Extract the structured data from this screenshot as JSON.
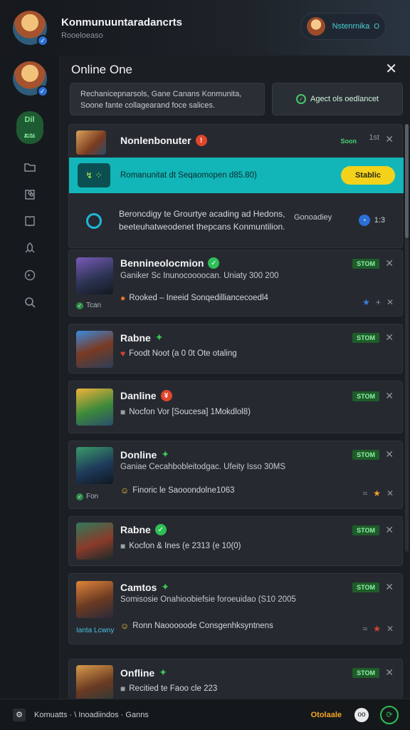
{
  "header": {
    "title": "Konmunuuntaradancrts",
    "subtitle": "Rooeloeaso",
    "user_name": "Nstenrnika",
    "user_status": "O"
  },
  "sidebar": {
    "pill_top": "Dil",
    "pill_bottom": "ಖಜ"
  },
  "panel": {
    "title": "Online One",
    "close": "✕",
    "info_text": "Rechanicepnarsols, Gane Canans Konmunita, Soone fante collagearand foce salices.",
    "select_label": "Agect ols oedlancet"
  },
  "highlight": {
    "title": "Nonlenbonuter",
    "tag": "Soon",
    "tag_extra": "1st",
    "teal_icon": "↯ ⁘",
    "teal_text": "Romanunitat dt Seqaomopen d85.80)",
    "play_label": "Stablic",
    "desc": "Beroncdigy te Grourtye acading ad Hedons, beeteuhatweodenet thepcans Konmuntilion.",
    "desc_right": "Gonoadiey",
    "score": "1:3"
  },
  "cards": [
    {
      "title": "Bennineolocmion",
      "badge": "ok",
      "line": "Ganiker Sc Inunocoooocan. Uniaty 300 200",
      "sub": "Rooked – Ineeid Sonqedilliancecoedl4",
      "tag": "STOM",
      "side": "Tcan"
    },
    {
      "title": "Rabne",
      "badge": "leaf",
      "line": "",
      "sub": "Foodt Noot (a 0 0t Ote otaling",
      "tag": "STOM",
      "side": ""
    },
    {
      "title": "Danline",
      "badge": "warn",
      "line": "",
      "sub": "Nocfon Vor [Soucesa] 1Mokdlol8)",
      "tag": "STOM",
      "side": ""
    },
    {
      "title": "Donline",
      "badge": "leaf",
      "line": "Ganiae Cecahbobleitodgac. Ufeity Isso 30MS",
      "sub": "Finoric le Saooondolne1063",
      "tag": "STOM",
      "side": "Fon"
    },
    {
      "title": "Rabne",
      "badge": "ok",
      "line": "",
      "sub": "Kocfon & Ines (e 2313 (e 10(0)",
      "tag": "STOM",
      "side": ""
    },
    {
      "title": "Camtos",
      "badge": "leaf",
      "line": "Somisosie Onahioobiefsie foroeuidao (S10 2005",
      "sub": "Ronn Naooooode Consgenhksyntnens",
      "tag": "STOM",
      "side": "Ianta Lcwny"
    },
    {
      "title": "Onfline",
      "badge": "leaf",
      "line": "",
      "sub": "Recitied te Faoo cle 223",
      "tag": "STOM",
      "side": ""
    }
  ],
  "footer": {
    "icon": "⚙",
    "text": "Komuatts · \\ Inoadiindos · Ganns",
    "status": "Otolaale",
    "btn1": "oo",
    "btn2": "⟳"
  },
  "colors": {
    "accent_teal": "#12b6b8",
    "play_yellow": "#f4d21c",
    "tag_green": "#1e5c2a",
    "ok_green": "#2fbf57",
    "warn_red": "#e0462b"
  }
}
